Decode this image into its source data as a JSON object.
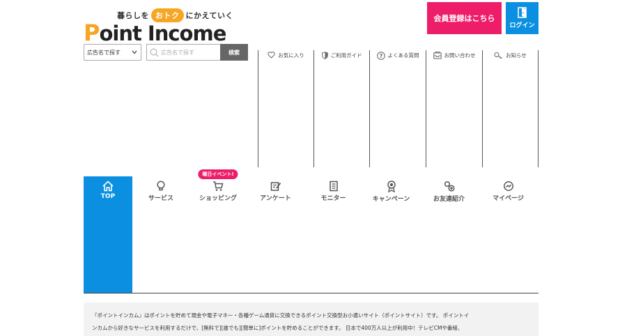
{
  "logo": {
    "tagline_pre": "暮らしを",
    "tagline_bubble": "おトク",
    "tagline_post": "にかえていく",
    "wordmark_first": "P",
    "wordmark_rest": "oint Income"
  },
  "header": {
    "register_label": "会員登録はこちら",
    "login_label": "ログイン"
  },
  "search": {
    "select_value": "広告名で探す",
    "input_placeholder": "広告名で探す",
    "button_label": "検索"
  },
  "util_nav": {
    "items": [
      {
        "label": "お気に入り",
        "icon": "heart-icon"
      },
      {
        "label": "ご利用ガイド",
        "icon": "shield-icon"
      },
      {
        "label": "よくある質問",
        "icon": "question-icon"
      },
      {
        "label": "お問い合わせ",
        "icon": "inbox-icon"
      },
      {
        "label": "お知らせ",
        "icon": "key-icon"
      }
    ]
  },
  "main_nav": {
    "event_badge": "曜日イベント!",
    "items": [
      {
        "label": "TOP",
        "icon": "home-icon",
        "active": true
      },
      {
        "label": "サービス",
        "icon": "lightbulb-icon"
      },
      {
        "label": "ショッピング",
        "icon": "cart-icon"
      },
      {
        "label": "アンケート",
        "icon": "survey-icon"
      },
      {
        "label": "モニター",
        "icon": "monitor-icon"
      },
      {
        "label": "キャンペーン",
        "icon": "medal-icon"
      },
      {
        "label": "お友達紹介",
        "icon": "friends-icon"
      },
      {
        "label": "マイページ",
        "icon": "mypage-icon"
      }
    ]
  },
  "description": {
    "line1": "『ポイントインカム』はポイントを貯めて現金や電子マネー・各種ゲーム通貨に交換できるポイント交換型お小遣いサイト（ポイントサイト）です。 ポイントイ",
    "line2": "ンカムから好きなサービスを利用するだけで、[無料で][誰でも][簡単に]ポイントを貯めることができます。 日本で400万人以上が利用中！テレビCMや番組、"
  },
  "colors": {
    "accent_blue": "#0b90e1",
    "accent_pink": "#ee1d6a",
    "logo_orange": "#f6a623"
  }
}
